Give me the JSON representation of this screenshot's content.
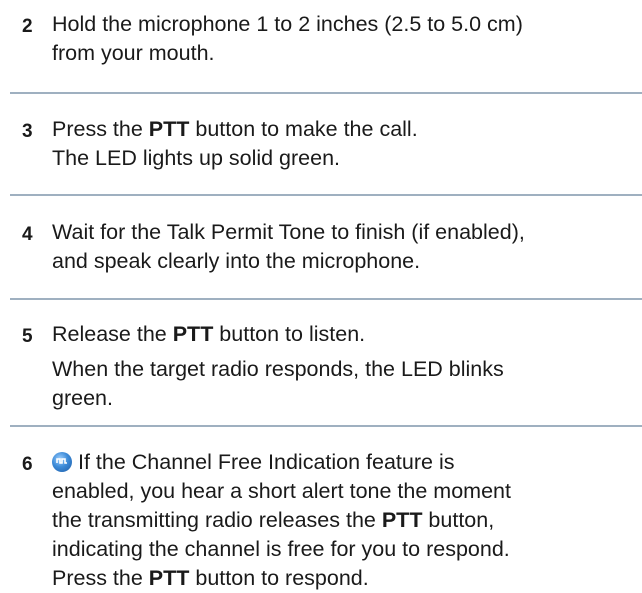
{
  "steps": [
    {
      "number": "2",
      "lines": [
        "Hold the microphone 1 to 2 inches (2.5 to 5.0 cm)",
        "from your mouth."
      ]
    },
    {
      "number": "3",
      "line1_pre": "Press the ",
      "line1_bold": "PTT",
      "line1_post": " button to make the call.",
      "line2": "The LED lights up solid green."
    },
    {
      "number": "4",
      "lines": [
        "Wait for the Talk Permit Tone to finish (if enabled),",
        "and speak clearly into the microphone."
      ]
    },
    {
      "number": "5",
      "line1_pre": "Release the ",
      "line1_bold": "PTT",
      "line1_post": " button to listen.",
      "line2": "When the target radio responds, the LED blinks",
      "line3": "green."
    },
    {
      "number": "6",
      "icon": "feature-indicator-icon",
      "line1": "If the Channel Free Indication feature is",
      "line2": "enabled, you hear a short alert tone the moment",
      "line3_pre": "the transmitting radio releases the ",
      "line3_bold": "PTT",
      "line3_post": " button,",
      "line4": "indicating the channel is free for you to respond.",
      "line5_pre": "Press the ",
      "line5_bold": "PTT",
      "line5_post": " button to respond."
    }
  ]
}
